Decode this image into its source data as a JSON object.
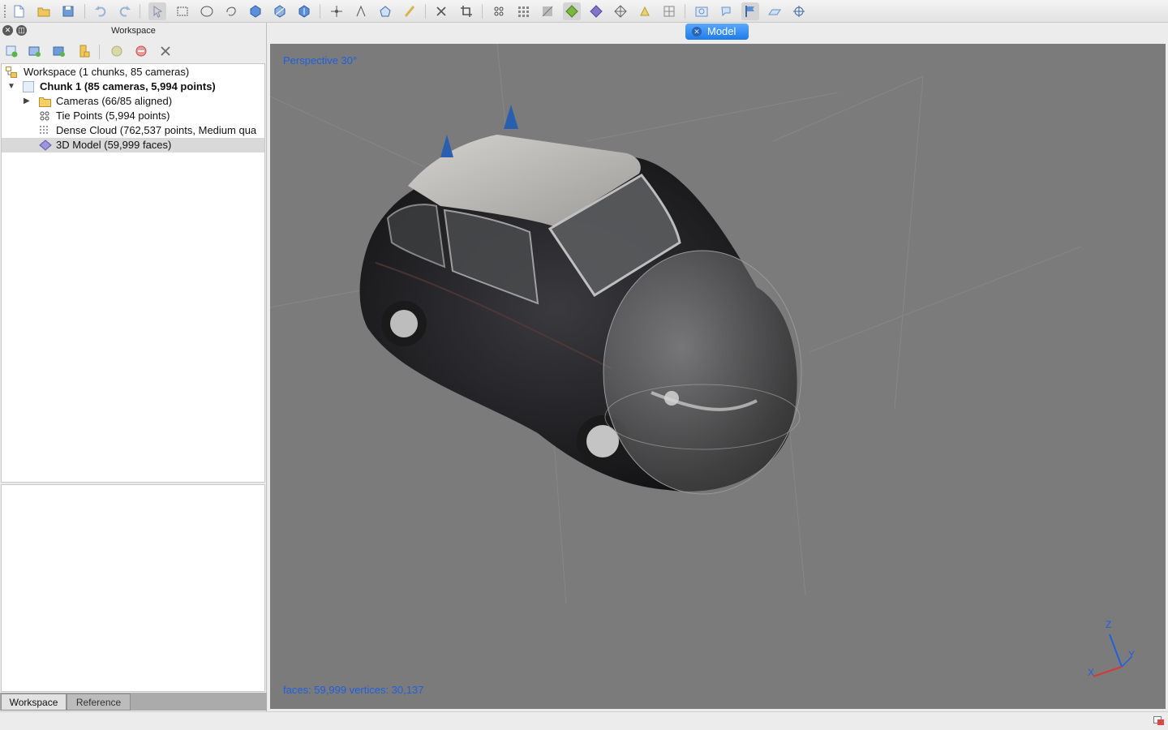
{
  "panel": {
    "title": "Workspace",
    "close_icon": "close-icon",
    "float_icon": "float-icon"
  },
  "tree": {
    "items": [
      {
        "label": "Workspace (1 chunks, 85 cameras)",
        "icon": "workspace-icon"
      },
      {
        "label": "Chunk 1 (85 cameras, 5,994 points)",
        "icon": "chunk-icon"
      },
      {
        "label": "Cameras (66/85 aligned)",
        "icon": "folder-icon"
      },
      {
        "label": "Tie Points (5,994 points)",
        "icon": "tie-points-icon"
      },
      {
        "label": "Dense Cloud (762,537 points, Medium qua",
        "icon": "dense-cloud-icon"
      },
      {
        "label": "3D Model (59,999 faces)",
        "icon": "model-icon"
      }
    ]
  },
  "tabs": {
    "workspace": "Workspace",
    "reference": "Reference"
  },
  "model": {
    "tab_label": "Model",
    "projection": "Perspective 30°",
    "stats": "faces: 59,999 vertices: 30,137",
    "axes": {
      "z": "Z",
      "y": "Y",
      "x": "X"
    }
  },
  "colors": {
    "accent": "#1f7be8",
    "overlay_text": "#1f5fe0",
    "viewport_bg": "#7b7b7b"
  }
}
